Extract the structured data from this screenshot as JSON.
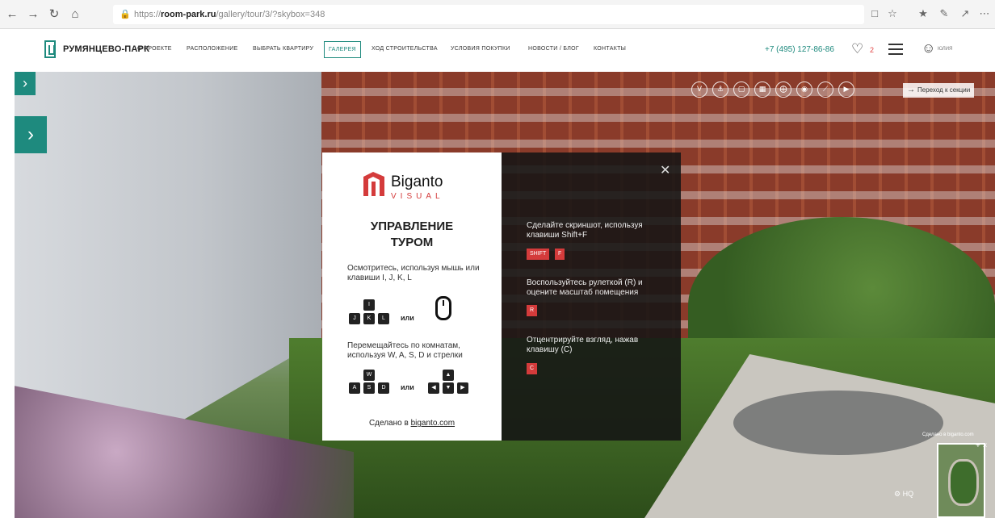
{
  "browser": {
    "url_prefix": "https://",
    "url_host": "room-park.ru",
    "url_path": "/gallery/tour/3/?skybox=348"
  },
  "site": {
    "brand": "РУМЯНЦЕВО-ПАРК",
    "nav": [
      {
        "label": "О ПРОЕКТЕ"
      },
      {
        "label": "РАСПОЛОЖЕНИЕ"
      },
      {
        "label": "ВЫБРАТЬ КВАРТИРУ"
      },
      {
        "label": "ГАЛЕРЕЯ",
        "active": true
      },
      {
        "label": "ХОД СТРОИТЕЛЬСТВА"
      },
      {
        "label": "УСЛОВИЯ ПОКУПКИ"
      },
      {
        "label": "НОВОСТИ / БЛОГ"
      },
      {
        "label": "КОНТАКТЫ"
      }
    ],
    "phone": "+7 (495) 127-86-86",
    "favorites_count": "2",
    "user_name": "ЮЛИЯ",
    "accent_color": "#1e8a7e"
  },
  "tour": {
    "section_link": "Переход к секции",
    "credit": "Сделано в biganto.com",
    "hq_label": "HQ",
    "minimap_controls": "+ ×"
  },
  "help": {
    "brand_name": "Biganto",
    "brand_sub": "VISUAL",
    "title_line1": "УПРАВЛЕНИЕ",
    "title_line2": "ТУРОМ",
    "look_text": "Осмотритесь, используя мышь или клавиши I, J, K, L",
    "move_text": "Перемещайтесь по комнатам, используя W, A, S, D и стрелки",
    "or_label": "или",
    "keys_look": [
      "I",
      "J",
      "K",
      "L"
    ],
    "keys_move": [
      "W",
      "A",
      "S",
      "D"
    ],
    "made_in_prefix": "Сделано в",
    "made_in_link": "biganto.com",
    "screenshot_text": "Сделайте скриншот, используя клавиши Shift+F",
    "screenshot_keys": [
      "SHIFT",
      "F"
    ],
    "ruler_text": "Воспользуйтесь рулеткой (R) и оцените масштаб помещения",
    "ruler_key": "R",
    "center_text": "Отцентрируйте взгляд, нажав клавишу (C)",
    "center_key": "C",
    "accent_color": "#d43b3b"
  }
}
